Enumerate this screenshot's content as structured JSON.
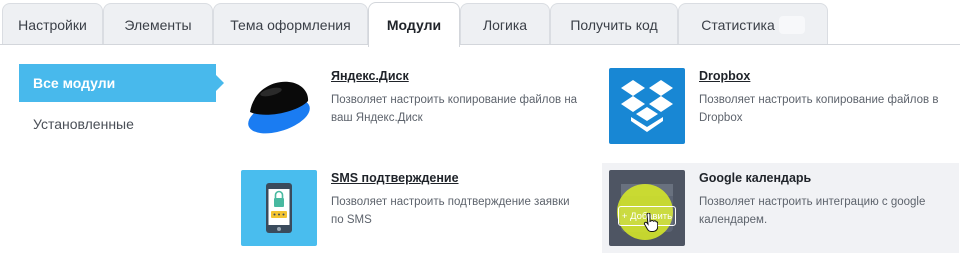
{
  "tabs": [
    {
      "label": "Настройки"
    },
    {
      "label": "Элементы"
    },
    {
      "label": "Тема оформления"
    },
    {
      "label": "Модули",
      "active": true
    },
    {
      "label": "Логика"
    },
    {
      "label": "Получить код"
    },
    {
      "label": "Статистика"
    }
  ],
  "sidebar": {
    "items": [
      {
        "label": "Все модули",
        "active": true
      },
      {
        "label": "Установленные"
      }
    ]
  },
  "modules": [
    {
      "title": "Яндекс.Диск",
      "description": "Позволяет настроить копирование файлов на ваш Яндекс.Диск",
      "icon": "yandex-disk-icon"
    },
    {
      "title": "Dropbox",
      "description": "Позволяет настроить копирование файлов в Dropbox",
      "icon": "dropbox-icon"
    },
    {
      "title": "SMS подтверждение",
      "description": "Позволяет настроить подтверждение заявки по SMS",
      "icon": "sms-phone-icon"
    },
    {
      "title": "Google календарь",
      "description": "Позволяет настроить интеграцию с google календарем.",
      "icon": "google-calendar-icon",
      "add_label": "+ Добавить"
    }
  ],
  "colors": {
    "accent": "#48b9ec",
    "dropbox": "#1887d4",
    "sms_bg": "#49bdee",
    "cursor_highlight": "#d6e828"
  }
}
